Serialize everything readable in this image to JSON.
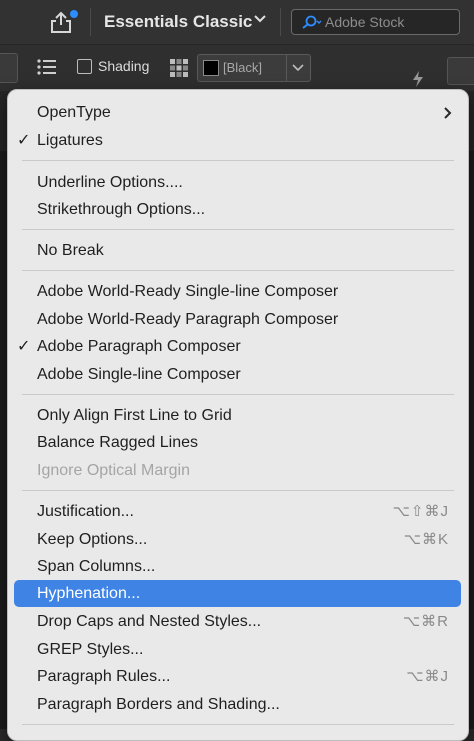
{
  "topbar": {
    "workspace_label": "Essentials Classic",
    "stock_placeholder": "Adobe Stock"
  },
  "controlbar": {
    "shading_label": "Shading",
    "swatch_value": "[Black]",
    "swatch_color": "#000000"
  },
  "colors": {
    "highlight": "#3f84e5",
    "menu_background": "#eae9e9",
    "badge_dot": "#2d8cff"
  },
  "menu": {
    "items": [
      {
        "label": "OpenType",
        "checked": false,
        "submenu": true,
        "shortcut": ""
      },
      {
        "label": "Ligatures",
        "checked": true,
        "submenu": false,
        "shortcut": ""
      },
      {
        "label": "Underline Options....",
        "checked": false,
        "submenu": false,
        "shortcut": ""
      },
      {
        "label": "Strikethrough Options...",
        "checked": false,
        "submenu": false,
        "shortcut": ""
      },
      {
        "label": "No Break",
        "checked": false,
        "submenu": false,
        "shortcut": ""
      },
      {
        "label": "Adobe World-Ready Single-line Composer",
        "checked": false,
        "submenu": false,
        "shortcut": ""
      },
      {
        "label": "Adobe World-Ready Paragraph Composer",
        "checked": false,
        "submenu": false,
        "shortcut": ""
      },
      {
        "label": "Adobe Paragraph Composer",
        "checked": true,
        "submenu": false,
        "shortcut": ""
      },
      {
        "label": "Adobe Single-line Composer",
        "checked": false,
        "submenu": false,
        "shortcut": ""
      },
      {
        "label": "Only Align First Line to Grid",
        "checked": false,
        "submenu": false,
        "shortcut": ""
      },
      {
        "label": "Balance Ragged Lines",
        "checked": false,
        "submenu": false,
        "shortcut": ""
      },
      {
        "label": "Ignore Optical Margin",
        "checked": false,
        "submenu": false,
        "shortcut": "",
        "disabled": true
      },
      {
        "label": "Justification...",
        "checked": false,
        "submenu": false,
        "shortcut": "⌥⇧⌘J"
      },
      {
        "label": "Keep Options...",
        "checked": false,
        "submenu": false,
        "shortcut": "⌥⌘K"
      },
      {
        "label": "Span Columns...",
        "checked": false,
        "submenu": false,
        "shortcut": ""
      },
      {
        "label": "Hyphenation...",
        "checked": false,
        "submenu": false,
        "shortcut": "",
        "highlighted": true
      },
      {
        "label": "Drop Caps and Nested Styles...",
        "checked": false,
        "submenu": false,
        "shortcut": "⌥⌘R"
      },
      {
        "label": "GREP Styles...",
        "checked": false,
        "submenu": false,
        "shortcut": ""
      },
      {
        "label": "Paragraph Rules...",
        "checked": false,
        "submenu": false,
        "shortcut": "⌥⌘J"
      },
      {
        "label": "Paragraph Borders and Shading...",
        "checked": false,
        "submenu": false,
        "shortcut": ""
      }
    ]
  }
}
